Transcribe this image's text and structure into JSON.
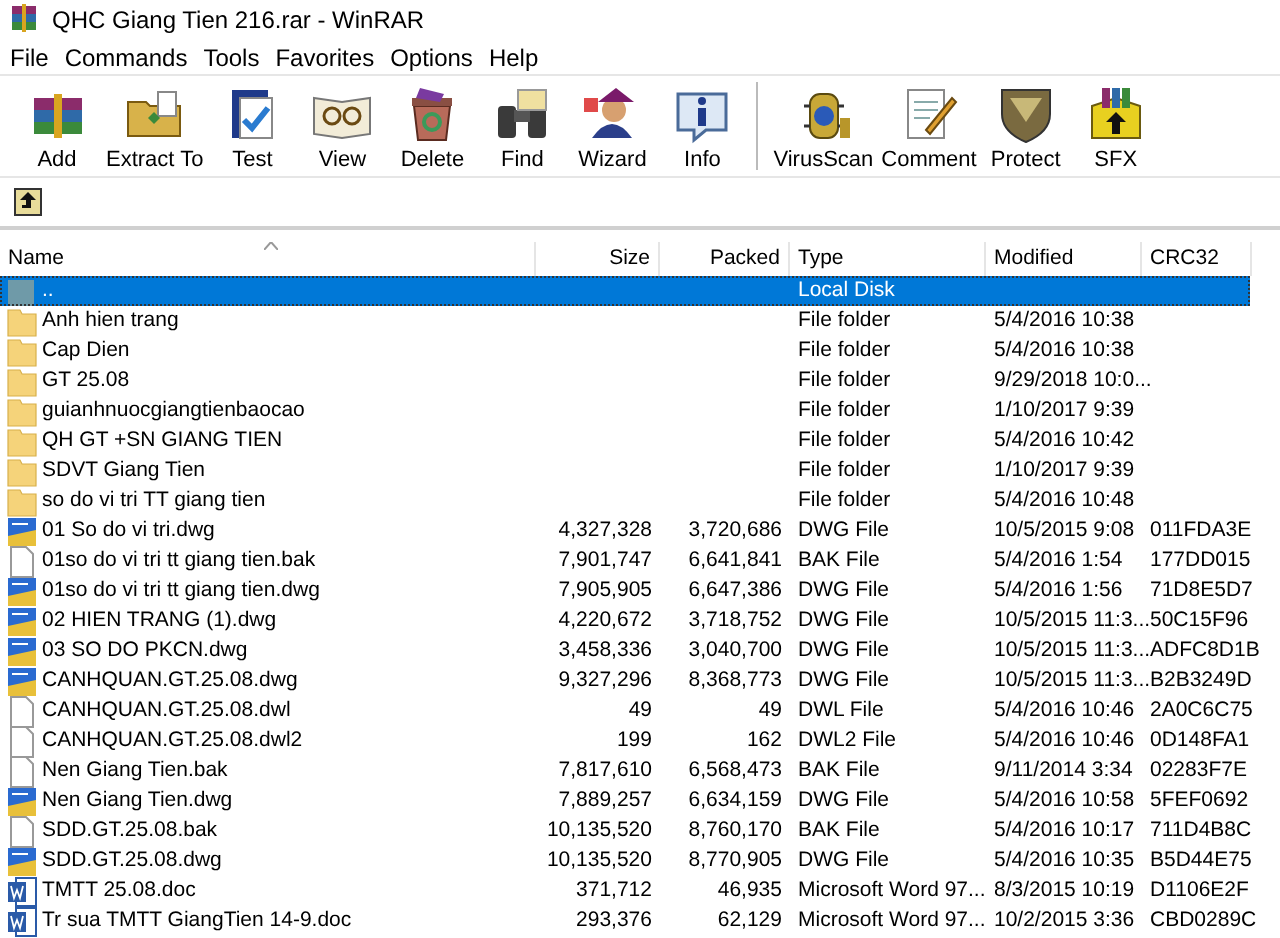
{
  "window": {
    "title": "QHC Giang Tien 216.rar - WinRAR"
  },
  "menu": [
    "File",
    "Commands",
    "Tools",
    "Favorites",
    "Options",
    "Help"
  ],
  "toolbar": {
    "groups": [
      [
        {
          "label": "Add",
          "kind": "add"
        },
        {
          "label": "Extract To",
          "kind": "extract"
        },
        {
          "label": "Test",
          "kind": "test"
        },
        {
          "label": "View",
          "kind": "view"
        },
        {
          "label": "Delete",
          "kind": "delete"
        },
        {
          "label": "Find",
          "kind": "find"
        },
        {
          "label": "Wizard",
          "kind": "wizard"
        },
        {
          "label": "Info",
          "kind": "info"
        }
      ],
      [
        {
          "label": "VirusScan",
          "kind": "scan"
        },
        {
          "label": "Comment",
          "kind": "comment"
        },
        {
          "label": "Protect",
          "kind": "protect"
        },
        {
          "label": "SFX",
          "kind": "sfx"
        }
      ]
    ]
  },
  "table": {
    "columns": [
      "Name",
      "Size",
      "Packed",
      "Type",
      "Modified",
      "CRC32"
    ],
    "rows": [
      {
        "kind": "parent",
        "selected": true,
        "cells": [
          "..",
          "",
          "",
          "Local Disk",
          "",
          ""
        ]
      },
      {
        "kind": "folder",
        "selected": false,
        "cells": [
          "Anh hien trang",
          "",
          "",
          "File folder",
          "5/4/2016 10:38",
          ""
        ]
      },
      {
        "kind": "folder",
        "selected": false,
        "cells": [
          "Cap Dien",
          "",
          "",
          "File folder",
          "5/4/2016 10:38",
          ""
        ]
      },
      {
        "kind": "folder",
        "selected": false,
        "cells": [
          "GT 25.08",
          "",
          "",
          "File folder",
          "9/29/2018 10:0...",
          ""
        ]
      },
      {
        "kind": "folder",
        "selected": false,
        "cells": [
          "guianhnuocgiangtienbaocao",
          "",
          "",
          "File folder",
          "1/10/2017 9:39",
          ""
        ]
      },
      {
        "kind": "folder",
        "selected": false,
        "cells": [
          "QH GT +SN GIANG TIEN",
          "",
          "",
          "File folder",
          "5/4/2016 10:42",
          ""
        ]
      },
      {
        "kind": "folder",
        "selected": false,
        "cells": [
          "SDVT Giang Tien",
          "",
          "",
          "File folder",
          "1/10/2017 9:39",
          ""
        ]
      },
      {
        "kind": "folder",
        "selected": false,
        "cells": [
          "so do vi tri TT giang tien",
          "",
          "",
          "File folder",
          "5/4/2016 10:48",
          ""
        ]
      },
      {
        "kind": "dwg",
        "selected": false,
        "cells": [
          "01 So do vi tri.dwg",
          "4,327,328",
          "3,720,686",
          "DWG File",
          "10/5/2015 9:08",
          "011FDA3E"
        ]
      },
      {
        "kind": "file",
        "selected": false,
        "cells": [
          "01so do vi tri tt giang tien.bak",
          "7,901,747",
          "6,641,841",
          "BAK File",
          "5/4/2016 1:54",
          "177DD015"
        ]
      },
      {
        "kind": "dwg",
        "selected": false,
        "cells": [
          "01so do vi tri tt giang tien.dwg",
          "7,905,905",
          "6,647,386",
          "DWG File",
          "5/4/2016 1:56",
          "71D8E5D7"
        ]
      },
      {
        "kind": "dwg",
        "selected": false,
        "cells": [
          "02 HIEN TRANG (1).dwg",
          "4,220,672",
          "3,718,752",
          "DWG File",
          "10/5/2015 11:3...",
          "50C15F96"
        ]
      },
      {
        "kind": "dwg",
        "selected": false,
        "cells": [
          "03 SO DO PKCN.dwg",
          "3,458,336",
          "3,040,700",
          "DWG File",
          "10/5/2015 11:3...",
          "ADFC8D1B"
        ]
      },
      {
        "kind": "dwg",
        "selected": false,
        "cells": [
          "CANHQUAN.GT.25.08.dwg",
          "9,327,296",
          "8,368,773",
          "DWG File",
          "10/5/2015 11:3...",
          "B2B3249D"
        ]
      },
      {
        "kind": "file",
        "selected": false,
        "cells": [
          "CANHQUAN.GT.25.08.dwl",
          "49",
          "49",
          "DWL File",
          "5/4/2016 10:46",
          "2A0C6C75"
        ]
      },
      {
        "kind": "file",
        "selected": false,
        "cells": [
          "CANHQUAN.GT.25.08.dwl2",
          "199",
          "162",
          "DWL2 File",
          "5/4/2016 10:46",
          "0D148FA1"
        ]
      },
      {
        "kind": "file",
        "selected": false,
        "cells": [
          "Nen Giang Tien.bak",
          "7,817,610",
          "6,568,473",
          "BAK File",
          "9/11/2014 3:34",
          "02283F7E"
        ]
      },
      {
        "kind": "dwg",
        "selected": false,
        "cells": [
          "Nen Giang Tien.dwg",
          "7,889,257",
          "6,634,159",
          "DWG File",
          "5/4/2016 10:58",
          "5FEF0692"
        ]
      },
      {
        "kind": "file",
        "selected": false,
        "cells": [
          "SDD.GT.25.08.bak",
          "10,135,520",
          "8,760,170",
          "BAK File",
          "5/4/2016 10:17",
          "711D4B8C"
        ]
      },
      {
        "kind": "dwg",
        "selected": false,
        "cells": [
          "SDD.GT.25.08.dwg",
          "10,135,520",
          "8,770,905",
          "DWG File",
          "5/4/2016 10:35",
          "B5D44E75"
        ]
      },
      {
        "kind": "doc",
        "selected": false,
        "cells": [
          "TMTT 25.08.doc",
          "371,712",
          "46,935",
          "Microsoft Word 97...",
          "8/3/2015 10:19",
          "D1106E2F"
        ]
      },
      {
        "kind": "doc",
        "selected": false,
        "cells": [
          "Tr sua TMTT GiangTien 14-9.doc",
          "293,376",
          "62,129",
          "Microsoft Word 97...",
          "10/2/2015 3:36",
          "CBD0289C"
        ]
      }
    ]
  }
}
